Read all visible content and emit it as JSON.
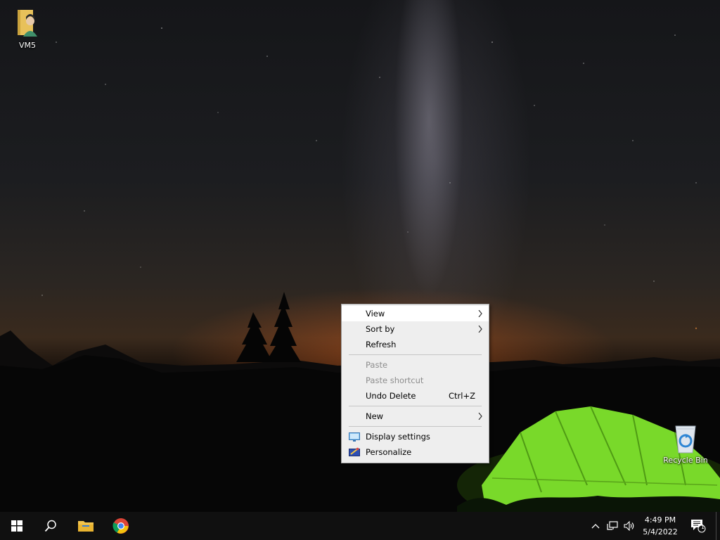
{
  "desktop": {
    "icons": [
      {
        "label": "VM5",
        "icon": "user-folder-icon"
      },
      {
        "label": "Recycle Bin",
        "icon": "recycle-bin-icon"
      }
    ]
  },
  "context_menu": {
    "items": {
      "view": "View",
      "sort_by": "Sort by",
      "refresh": "Refresh",
      "paste": "Paste",
      "paste_shortcut": "Paste shortcut",
      "undo_delete": "Undo Delete",
      "undo_delete_shortcut": "Ctrl+Z",
      "new": "New",
      "display_settings": "Display settings",
      "personalize": "Personalize"
    }
  },
  "taskbar": {
    "pinned": [
      "start-icon",
      "search-icon",
      "file-explorer-icon",
      "chrome-icon"
    ],
    "tray": [
      "chevron-up-icon",
      "network-icon",
      "volume-icon"
    ],
    "clock": {
      "time": "4:49 PM",
      "date": "5/4/2022"
    },
    "notifications": {
      "count": "1"
    }
  },
  "colors": {
    "taskbar": "#101010",
    "menu_bg": "#eeeeee",
    "menu_hover": "#ffffff",
    "tent": "#7ee02a"
  }
}
